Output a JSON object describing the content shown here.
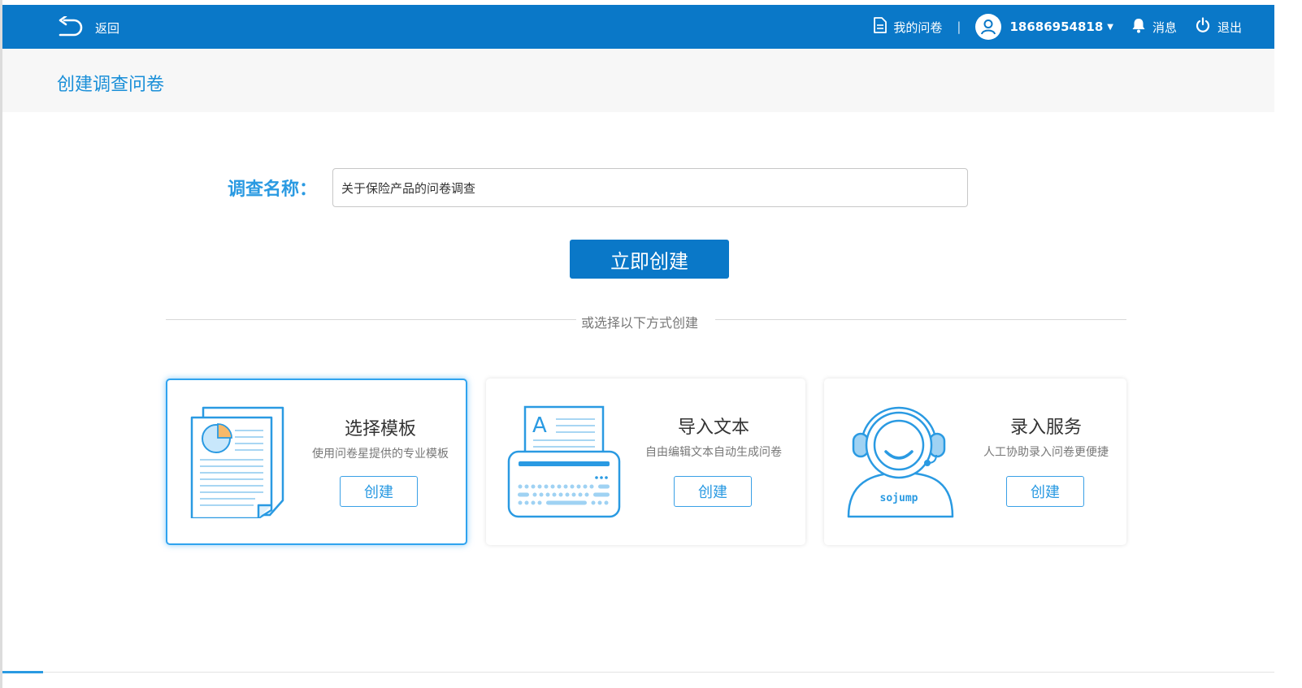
{
  "topbar": {
    "back_label": "返回",
    "my_surveys_label": "我的问卷",
    "separator": "|",
    "username": "18686954818",
    "messages_label": "消息",
    "logout_label": "退出"
  },
  "page": {
    "title": "创建调查问卷"
  },
  "form": {
    "name_label": "调查名称：",
    "name_value": "关于保险产品的问卷调查",
    "create_button": "立即创建"
  },
  "divider_text": "或选择以下方式创建",
  "cards": [
    {
      "title": "选择模板",
      "desc": "使用问卷星提供的专业模板",
      "button": "创建"
    },
    {
      "title": "导入文本",
      "desc": "自由编辑文本自动生成问卷",
      "button": "创建"
    },
    {
      "title": "录入服务",
      "desc": "人工协助录入问卷更便捷",
      "button": "创建",
      "logo_text": "sojump"
    }
  ],
  "colors": {
    "primary": "#0a78c8",
    "accent": "#2a9ae2",
    "subheader_bg": "#f7f7f7"
  }
}
